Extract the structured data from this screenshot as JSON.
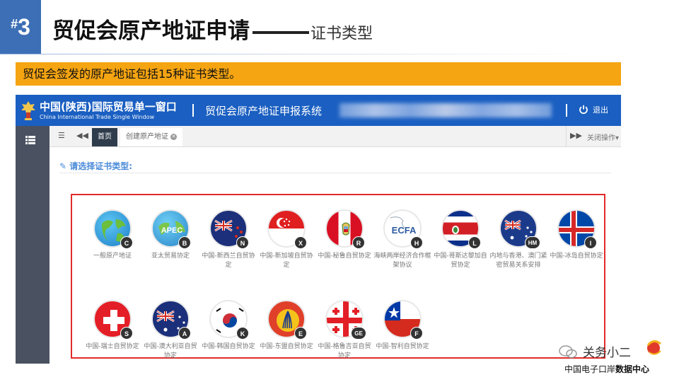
{
  "slide": {
    "number_hash": "#",
    "number": "3",
    "title": "贸促会原产地证申请",
    "subtitle": "证书类型",
    "banner": "贸促会签发的原产地证包括15种证书类型。"
  },
  "app": {
    "brand_cn": "中国(陕西)国际贸易单一窗口",
    "brand_en": "China International Trade Single Window",
    "system_title": "贸促会原产地证申报系统",
    "logout": "退出",
    "tabs": {
      "home": "首页",
      "create": "创建原产地证",
      "close_ops": "关闭操作▾"
    },
    "section_label": "请选择证书类型:",
    "cert_types": [
      {
        "label": "一般原产地证",
        "badge": "C",
        "icon": "globe-icon"
      },
      {
        "label": "亚太贸易协定",
        "badge": "B",
        "icon": "apec-icon"
      },
      {
        "label": "中国-新西兰自贸协定",
        "badge": "N",
        "icon": "new-zealand-flag-icon"
      },
      {
        "label": "中国-新加坡自贸协定",
        "badge": "X",
        "icon": "singapore-flag-icon"
      },
      {
        "label": "中国-秘鲁自贸协定",
        "badge": "R",
        "icon": "peru-flag-icon"
      },
      {
        "label": "海峡两岸经济合作框架协议",
        "badge": "H",
        "icon": "ecfa-icon"
      },
      {
        "label": "中国-哥斯达黎加自贸协定",
        "badge": "L",
        "icon": "costa-rica-flag-icon"
      },
      {
        "label": "内地与香港、澳门紧密贸易关系安排",
        "badge": "HM",
        "icon": "hk-macau-icon"
      },
      {
        "label": "中国-冰岛自贸协定",
        "badge": "I",
        "icon": "iceland-flag-icon"
      },
      {
        "label": "中国-瑞士自贸协定",
        "badge": "S",
        "icon": "switzerland-flag-icon"
      },
      {
        "label": "中国-澳大利亚自贸协定",
        "badge": "A",
        "icon": "australia-flag-icon"
      },
      {
        "label": "中国-韩国自贸协定",
        "badge": "K",
        "icon": "korea-flag-icon"
      },
      {
        "label": "中国-东盟自贸协定",
        "badge": "E",
        "icon": "asean-icon"
      },
      {
        "label": "中国-格鲁吉亚自贸协定",
        "badge": "GE",
        "icon": "georgia-flag-icon"
      },
      {
        "label": "中国-智利自贸协定",
        "badge": "F",
        "icon": "chile-flag-icon"
      }
    ]
  },
  "watermark": {
    "top": "关务小二",
    "bottom_normal": "中国电子口岸",
    "bottom_bold": "数据中心"
  }
}
